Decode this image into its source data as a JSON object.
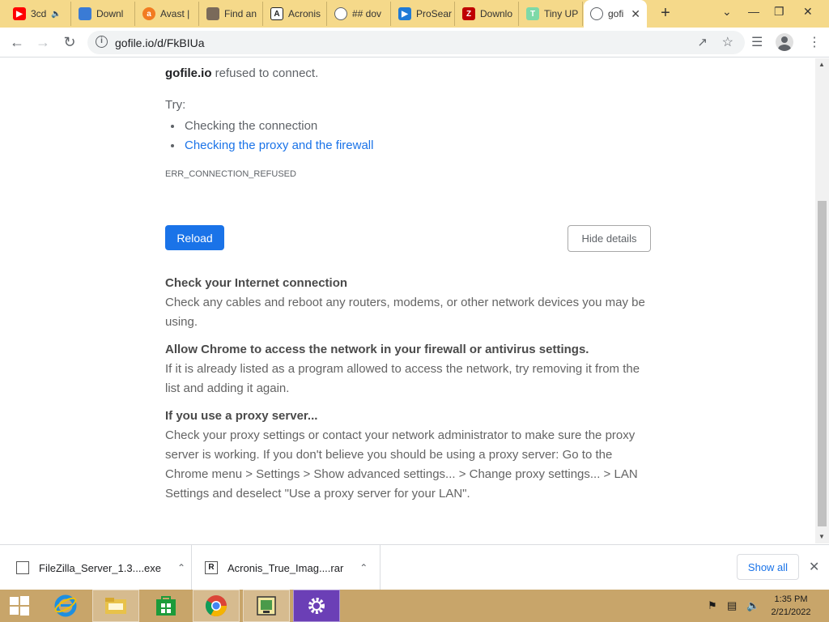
{
  "tabs": [
    {
      "label": "3cd",
      "favicon": "youtube-icon",
      "color": "#ff0000",
      "muted_icon": "speaker-icon"
    },
    {
      "label": "Downl",
      "favicon": "bird-icon",
      "color": "#3a7bd5"
    },
    {
      "label": "Avast |",
      "favicon": "avast-icon",
      "color": "#f27b21"
    },
    {
      "label": "Find an",
      "favicon": "wrench-icon",
      "color": "#7a6a5a"
    },
    {
      "label": "Acronis",
      "favicon": "acronis-icon",
      "color": "#222222"
    },
    {
      "label": "## dov",
      "favicon": "globe-icon",
      "color": "#5f6368"
    },
    {
      "label": "ProSear",
      "favicon": "prosearch-icon",
      "color": "#1f7ad6"
    },
    {
      "label": "Downlo",
      "favicon": "filezilla-icon",
      "color": "#bf0000"
    },
    {
      "label": "Tiny UP",
      "favicon": "tinyupload-icon",
      "color": "#7ed9a8"
    },
    {
      "label": "gofi",
      "favicon": "globe-icon",
      "color": "#5f6368",
      "active": true
    }
  ],
  "address_bar": {
    "url": "gofile.io/d/FkBIUa"
  },
  "error_page": {
    "host": "gofile.io",
    "message": "refused to connect.",
    "try_label": "Try:",
    "suggestions": [
      "Checking the connection",
      "Checking the proxy and the firewall"
    ],
    "error_code": "ERR_CONNECTION_REFUSED",
    "reload_label": "Reload",
    "hide_details_label": "Hide details",
    "details": [
      {
        "title": "Check your Internet connection",
        "body": "Check any cables and reboot any routers, modems, or other network devices you may be using."
      },
      {
        "title": "Allow Chrome to access the network in your firewall or antivirus settings.",
        "body": "If it is already listed as a program allowed to access the network, try removing it from the list and adding it again."
      },
      {
        "title": "If you use a proxy server...",
        "body": "Check your proxy settings or contact your network administrator to make sure the proxy server is working. If you don't believe you should be using a proxy server: Go to the Chrome menu > Settings > Show advanced settings... > Change proxy settings... > LAN Settings and deselect \"Use a proxy server for your LAN\"."
      }
    ]
  },
  "downloads": {
    "items": [
      {
        "name": "FileZilla_Server_1.3....exe",
        "icon": "exe-file-icon"
      },
      {
        "name": "Acronis_True_Imag....rar",
        "icon": "rar-file-icon"
      }
    ],
    "show_all_label": "Show all"
  },
  "taskbar": {
    "apps": [
      "start-icon",
      "internet-explorer-icon",
      "file-explorer-icon",
      "store-icon",
      "chrome-icon",
      "app-icon",
      "settings-icon"
    ],
    "time": "1:35 PM",
    "date": "2/21/2022"
  },
  "colors": {
    "accent": "#1a73e8",
    "tabstrip": "#f5d98a",
    "taskbar": "#c8a56a"
  }
}
